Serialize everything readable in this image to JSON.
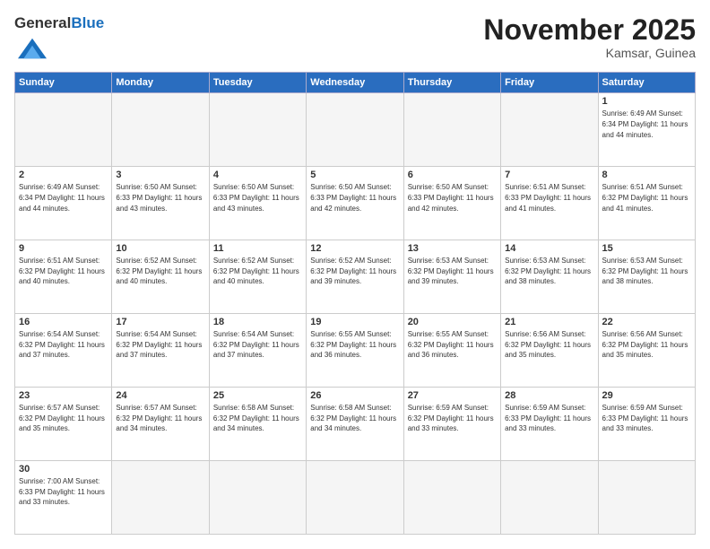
{
  "header": {
    "logo_general": "General",
    "logo_blue": "Blue",
    "month_title": "November 2025",
    "location": "Kamsar, Guinea"
  },
  "weekdays": [
    "Sunday",
    "Monday",
    "Tuesday",
    "Wednesday",
    "Thursday",
    "Friday",
    "Saturday"
  ],
  "weeks": [
    [
      {
        "day": "",
        "info": ""
      },
      {
        "day": "",
        "info": ""
      },
      {
        "day": "",
        "info": ""
      },
      {
        "day": "",
        "info": ""
      },
      {
        "day": "",
        "info": ""
      },
      {
        "day": "",
        "info": ""
      },
      {
        "day": "1",
        "info": "Sunrise: 6:49 AM\nSunset: 6:34 PM\nDaylight: 11 hours\nand 44 minutes."
      }
    ],
    [
      {
        "day": "2",
        "info": "Sunrise: 6:49 AM\nSunset: 6:34 PM\nDaylight: 11 hours\nand 44 minutes."
      },
      {
        "day": "3",
        "info": "Sunrise: 6:50 AM\nSunset: 6:33 PM\nDaylight: 11 hours\nand 43 minutes."
      },
      {
        "day": "4",
        "info": "Sunrise: 6:50 AM\nSunset: 6:33 PM\nDaylight: 11 hours\nand 43 minutes."
      },
      {
        "day": "5",
        "info": "Sunrise: 6:50 AM\nSunset: 6:33 PM\nDaylight: 11 hours\nand 42 minutes."
      },
      {
        "day": "6",
        "info": "Sunrise: 6:50 AM\nSunset: 6:33 PM\nDaylight: 11 hours\nand 42 minutes."
      },
      {
        "day": "7",
        "info": "Sunrise: 6:51 AM\nSunset: 6:33 PM\nDaylight: 11 hours\nand 41 minutes."
      },
      {
        "day": "8",
        "info": "Sunrise: 6:51 AM\nSunset: 6:32 PM\nDaylight: 11 hours\nand 41 minutes."
      }
    ],
    [
      {
        "day": "9",
        "info": "Sunrise: 6:51 AM\nSunset: 6:32 PM\nDaylight: 11 hours\nand 40 minutes."
      },
      {
        "day": "10",
        "info": "Sunrise: 6:52 AM\nSunset: 6:32 PM\nDaylight: 11 hours\nand 40 minutes."
      },
      {
        "day": "11",
        "info": "Sunrise: 6:52 AM\nSunset: 6:32 PM\nDaylight: 11 hours\nand 40 minutes."
      },
      {
        "day": "12",
        "info": "Sunrise: 6:52 AM\nSunset: 6:32 PM\nDaylight: 11 hours\nand 39 minutes."
      },
      {
        "day": "13",
        "info": "Sunrise: 6:53 AM\nSunset: 6:32 PM\nDaylight: 11 hours\nand 39 minutes."
      },
      {
        "day": "14",
        "info": "Sunrise: 6:53 AM\nSunset: 6:32 PM\nDaylight: 11 hours\nand 38 minutes."
      },
      {
        "day": "15",
        "info": "Sunrise: 6:53 AM\nSunset: 6:32 PM\nDaylight: 11 hours\nand 38 minutes."
      }
    ],
    [
      {
        "day": "16",
        "info": "Sunrise: 6:54 AM\nSunset: 6:32 PM\nDaylight: 11 hours\nand 37 minutes."
      },
      {
        "day": "17",
        "info": "Sunrise: 6:54 AM\nSunset: 6:32 PM\nDaylight: 11 hours\nand 37 minutes."
      },
      {
        "day": "18",
        "info": "Sunrise: 6:54 AM\nSunset: 6:32 PM\nDaylight: 11 hours\nand 37 minutes."
      },
      {
        "day": "19",
        "info": "Sunrise: 6:55 AM\nSunset: 6:32 PM\nDaylight: 11 hours\nand 36 minutes."
      },
      {
        "day": "20",
        "info": "Sunrise: 6:55 AM\nSunset: 6:32 PM\nDaylight: 11 hours\nand 36 minutes."
      },
      {
        "day": "21",
        "info": "Sunrise: 6:56 AM\nSunset: 6:32 PM\nDaylight: 11 hours\nand 35 minutes."
      },
      {
        "day": "22",
        "info": "Sunrise: 6:56 AM\nSunset: 6:32 PM\nDaylight: 11 hours\nand 35 minutes."
      }
    ],
    [
      {
        "day": "23",
        "info": "Sunrise: 6:57 AM\nSunset: 6:32 PM\nDaylight: 11 hours\nand 35 minutes."
      },
      {
        "day": "24",
        "info": "Sunrise: 6:57 AM\nSunset: 6:32 PM\nDaylight: 11 hours\nand 34 minutes."
      },
      {
        "day": "25",
        "info": "Sunrise: 6:58 AM\nSunset: 6:32 PM\nDaylight: 11 hours\nand 34 minutes."
      },
      {
        "day": "26",
        "info": "Sunrise: 6:58 AM\nSunset: 6:32 PM\nDaylight: 11 hours\nand 34 minutes."
      },
      {
        "day": "27",
        "info": "Sunrise: 6:59 AM\nSunset: 6:32 PM\nDaylight: 11 hours\nand 33 minutes."
      },
      {
        "day": "28",
        "info": "Sunrise: 6:59 AM\nSunset: 6:33 PM\nDaylight: 11 hours\nand 33 minutes."
      },
      {
        "day": "29",
        "info": "Sunrise: 6:59 AM\nSunset: 6:33 PM\nDaylight: 11 hours\nand 33 minutes."
      }
    ],
    [
      {
        "day": "30",
        "info": "Sunrise: 7:00 AM\nSunset: 6:33 PM\nDaylight: 11 hours\nand 33 minutes."
      },
      {
        "day": "",
        "info": ""
      },
      {
        "day": "",
        "info": ""
      },
      {
        "day": "",
        "info": ""
      },
      {
        "day": "",
        "info": ""
      },
      {
        "day": "",
        "info": ""
      },
      {
        "day": "",
        "info": ""
      }
    ]
  ]
}
